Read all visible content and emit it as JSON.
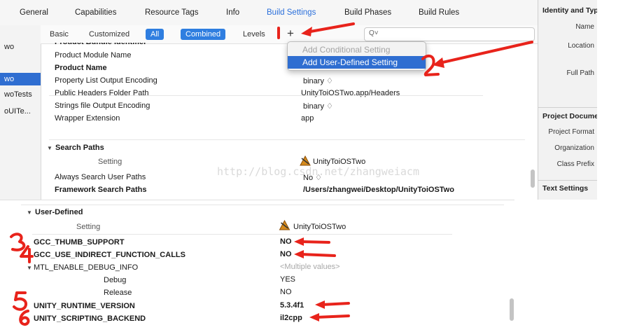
{
  "tabs": [
    "General",
    "Capabilities",
    "Resource Tags",
    "Info",
    "Build Settings",
    "Build Phases",
    "Build Rules"
  ],
  "active_tab": "Build Settings",
  "left_nav": [
    "wo",
    "wo",
    "woTests",
    "oUITe..."
  ],
  "filters": {
    "basic": "Basic",
    "customized": "Customized",
    "all": "All",
    "combined": "Combined",
    "levels": "Levels",
    "add": "+",
    "search_icon": "Q˅"
  },
  "popup": {
    "item1": "Add Conditional Setting",
    "item2": "Add User-Defined Setting"
  },
  "packaging": {
    "partial_row": "Product Bundle Identifier",
    "rows": [
      {
        "name": "Product Module Name",
        "value": ""
      },
      {
        "name": "Product Name",
        "value": ""
      },
      {
        "name": "Property List Output Encoding",
        "value": "binary ♢"
      },
      {
        "name": "Public Headers Folder Path",
        "value": "UnityToiOSTwo.app/Headers"
      },
      {
        "name": "Strings file Output Encoding",
        "value": "binary ♢"
      },
      {
        "name": "Wrapper Extension",
        "value": "app"
      }
    ]
  },
  "search_paths": {
    "header": "Search Paths",
    "setting_col": "Setting",
    "target_col": "UnityToiOSTwo",
    "rows": [
      {
        "name": "Always Search User Paths",
        "value": "No ♢"
      },
      {
        "name": "Framework Search Paths",
        "value": "/Users/zhangwei/Desktop/UnityToiOSTwo"
      }
    ]
  },
  "watermark": "http://blog.csdn.net/zhangweiacm",
  "inspector": {
    "identity_header": "Identity and Type",
    "name": "Name",
    "location": "Location",
    "full_path": "Full Path",
    "project_doc_header": "Project Document",
    "project_format": "Project Format",
    "organization": "Organization",
    "class_prefix": "Class Prefix",
    "text_settings_header": "Text Settings"
  },
  "user_defined": {
    "header": "User-Defined",
    "setting_col": "Setting",
    "target_col": "UnityToiOSTwo",
    "rows": [
      {
        "name": "GCC_THUMB_SUPPORT",
        "value": "NO"
      },
      {
        "name": "GCC_USE_INDIRECT_FUNCTION_CALLS",
        "value": "NO"
      },
      {
        "name": "MTL_ENABLE_DEBUG_INFO",
        "value": "<Multiple values>"
      },
      {
        "name": "Debug",
        "value": "YES"
      },
      {
        "name": "Release",
        "value": "NO"
      },
      {
        "name": "UNITY_RUNTIME_VERSION",
        "value": "5.3.4f1"
      },
      {
        "name": "UNITY_SCRIPTING_BACKEND",
        "value": "il2cpp"
      }
    ]
  },
  "annotations": [
    "1",
    "2",
    "3",
    "4",
    "5",
    "6"
  ],
  "colors": {
    "accent": "#2f6ed1",
    "annotation_red": "#e8231b",
    "disabled": "#a3a3a3"
  }
}
